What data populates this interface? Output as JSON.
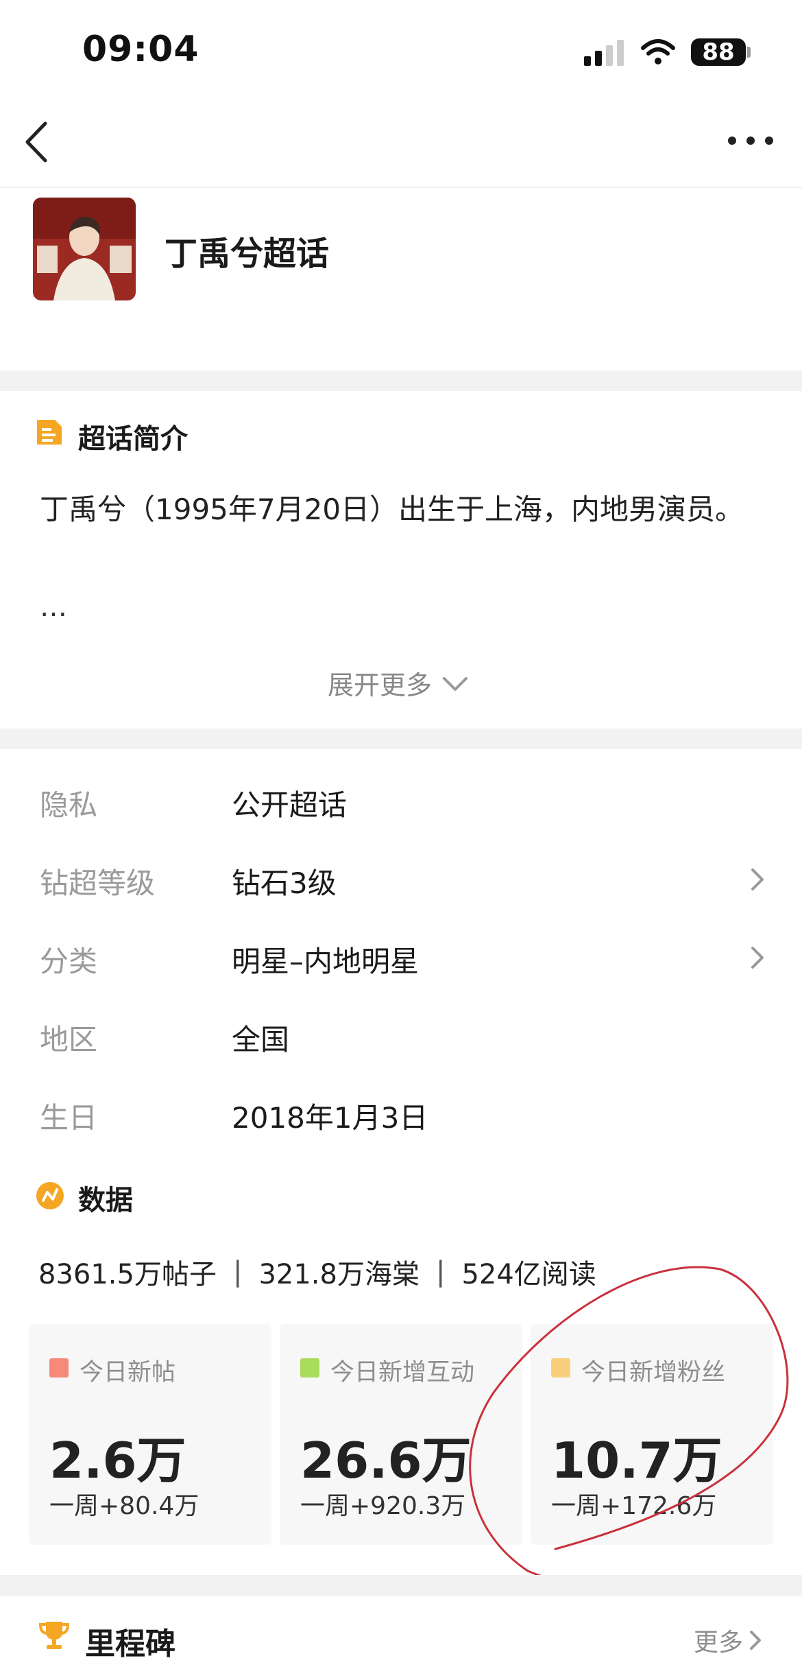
{
  "status_bar": {
    "time": "09:04",
    "battery": "88"
  },
  "header": {
    "title": "丁禹兮超话"
  },
  "intro": {
    "heading": "超话简介",
    "text": "丁禹兮（1995年7月20日）出生于上海，内地男演员。",
    "ellipsis": "…",
    "expand_label": "展开更多"
  },
  "info_rows": [
    {
      "label": "隐私",
      "value": "公开超话",
      "chevron": false
    },
    {
      "label": "钻超等级",
      "value": "钻石3级",
      "chevron": true
    },
    {
      "label": "分类",
      "value": "明星–内地明星",
      "chevron": true
    },
    {
      "label": "地区",
      "value": "全国",
      "chevron": false
    },
    {
      "label": "生日",
      "value": "2018年1月3日",
      "chevron": false
    }
  ],
  "data_section": {
    "heading": "数据",
    "stats": [
      "8361.5万帖子",
      "321.8万海棠",
      "524亿阅读"
    ],
    "separator": "|",
    "cards": [
      {
        "label": "今日新帖",
        "value": "2.6万",
        "week": "一周+80.4万",
        "color": "#f7897a"
      },
      {
        "label": "今日新增互动",
        "value": "26.6万",
        "week": "一周+920.3万",
        "color": "#a8dc5a"
      },
      {
        "label": "今日新增粉丝",
        "value": "10.7万",
        "week": "一周+172.6万",
        "color": "#f8cf7a"
      }
    ]
  },
  "milestone": {
    "heading": "里程碑",
    "more_label": "更多"
  },
  "colors": {
    "accent_orange": "#f5a623",
    "annotation_red": "#c8323c",
    "gap_gray": "#f2f2f2"
  },
  "icons": {
    "back": "chevron-left-icon",
    "more": "more-dots-icon",
    "intro": "document-icon",
    "data": "data-chart-icon",
    "milestone": "trophy-icon"
  }
}
